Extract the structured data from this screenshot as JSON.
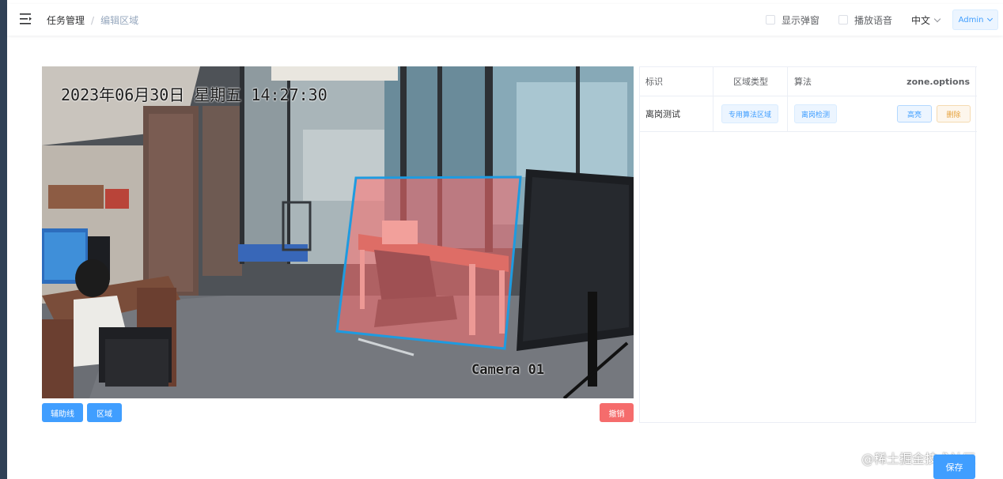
{
  "header": {
    "breadcrumb_main": "任务管理",
    "breadcrumb_sep": "/",
    "breadcrumb_current": "编辑区域",
    "show_popup_label": "显示弹窗",
    "play_voice_label": "播放语音",
    "language": "中文",
    "user": "Admin"
  },
  "camera": {
    "osd_datetime": "2023年06月30日  星期五  14:27:30",
    "osd_camera": "Camera 01",
    "zone_color": "#1e9be0"
  },
  "toolbar": {
    "guide_line_label": "辅助线",
    "zone_label": "区域",
    "undo_label": "撤销"
  },
  "zone_table": {
    "columns": [
      "标识",
      "区域类型",
      "算法",
      "zone.options"
    ],
    "rows": [
      {
        "id": "离岗测试",
        "zone_type": "专用算法区域",
        "algorithm": "离岗检测",
        "action_edit": "高亮",
        "action_delete": "删除"
      }
    ]
  },
  "footer": {
    "save_label": "保存",
    "watermark": "@稀土掘金技术社区"
  },
  "colors": {
    "primary": "#409eff",
    "danger": "#f56c6c",
    "warning": "#e6a23c",
    "sidebar": "#304156"
  },
  "icons": {
    "menu_toggle": "hamburger-icon",
    "dropdown": "chevron-down-icon"
  }
}
